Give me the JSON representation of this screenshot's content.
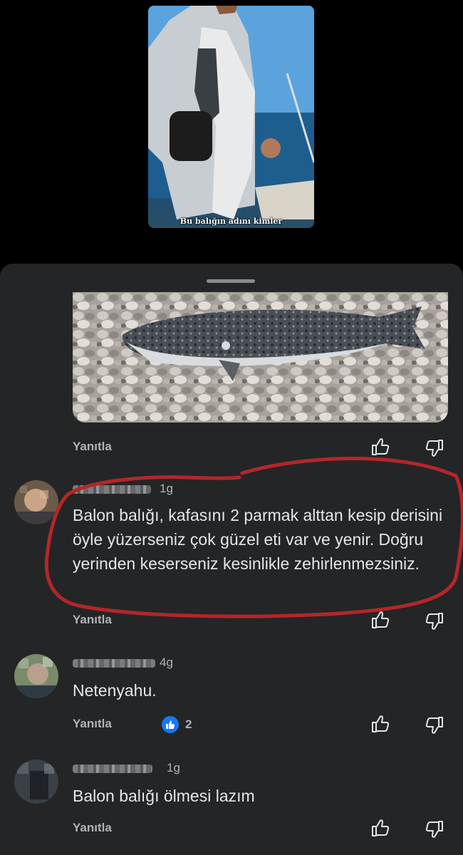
{
  "video": {
    "caption": "Bu balığın adını kimler"
  },
  "comments": [
    {
      "time": "1g",
      "text": "Balon balığı, kafasını 2 parmak alttan kesip derisini öyle yüzerseniz çok güzel eti var ve yenir. Doğru yerinden keserseniz kesinlikle zehirlenmezsiniz."
    },
    {
      "time": "4g",
      "text": "Netenyahu.",
      "reaction_count": "2"
    },
    {
      "time": "1g",
      "text": "Balon balığı ölmesi lazım"
    }
  ],
  "actions": {
    "reply_label": "Yanıtla"
  },
  "icons": {
    "like": "thumbs-up-icon",
    "dislike": "thumbs-down-icon",
    "reaction": "like-reaction-icon"
  },
  "colors": {
    "sheet": "#242526",
    "reaction_blue": "#1877f2",
    "highlight_circle": "#b3262a",
    "text": "#e4e6eb",
    "muted": "#b0b3b8"
  }
}
